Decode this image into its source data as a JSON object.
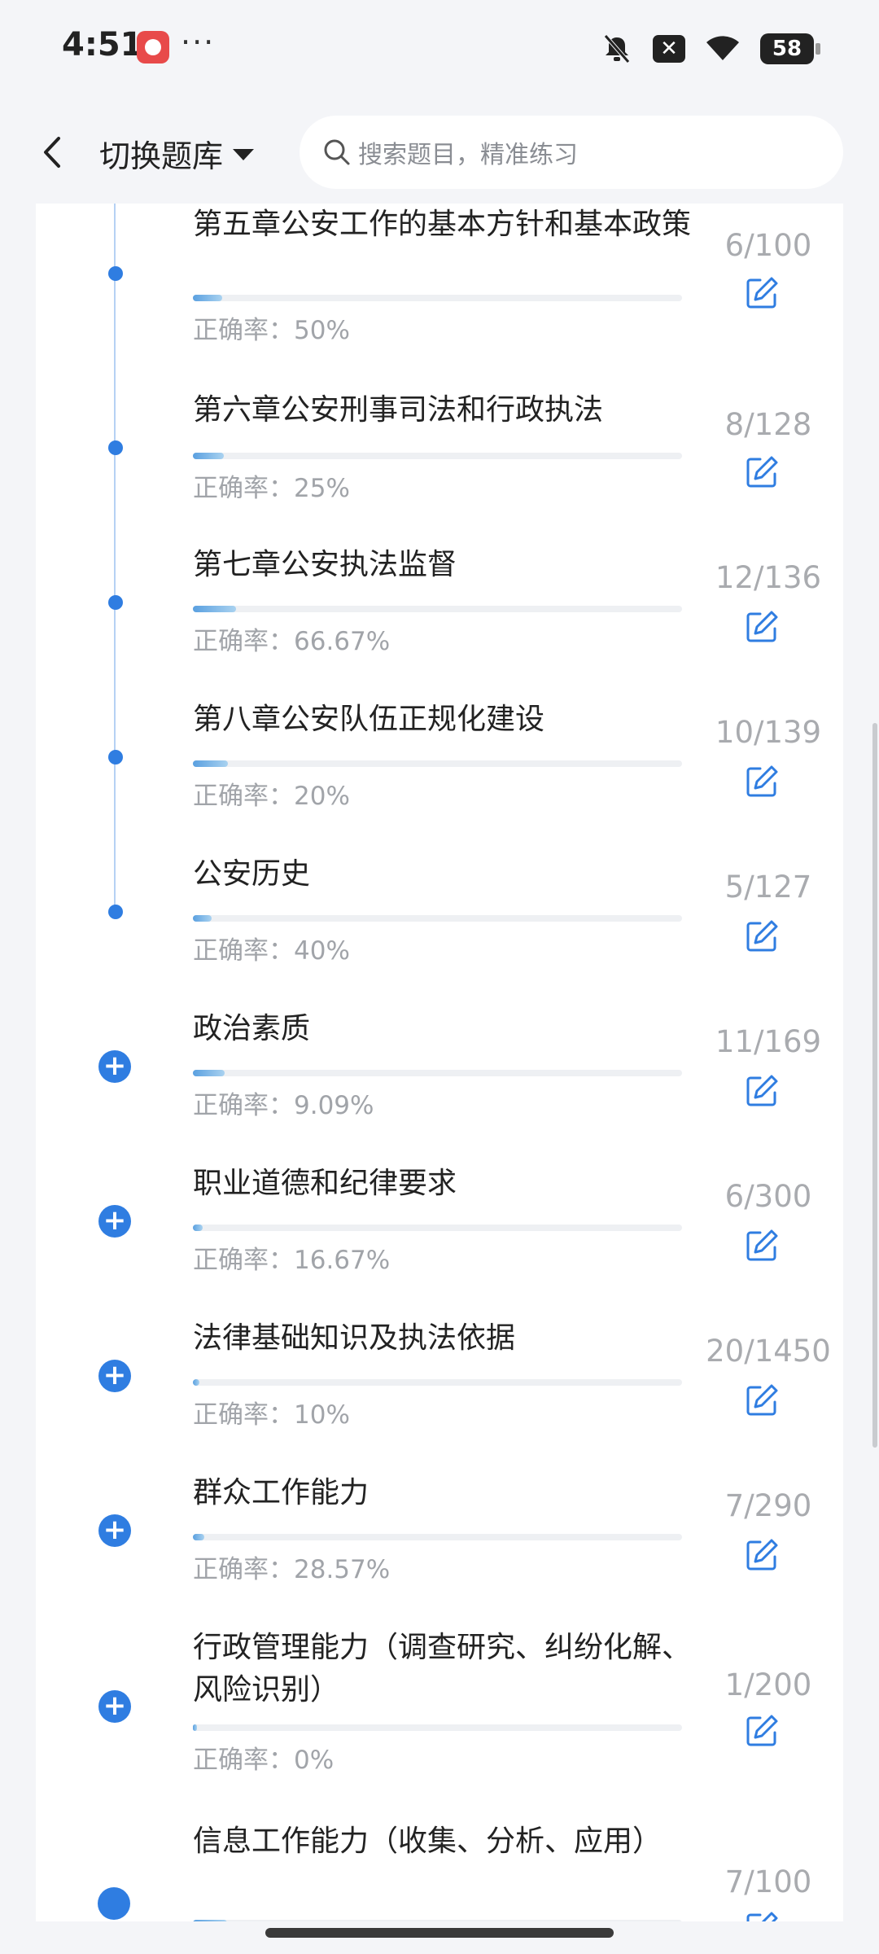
{
  "status_bar": {
    "time": "4:51",
    "more": "···",
    "battery": "58"
  },
  "header": {
    "back_icon": "chevron-left-icon",
    "switch_label": "切换题库",
    "search_placeholder": "搜索题目，精准练习"
  },
  "accent_color": "#2f7de1",
  "accuracy_label": "正确率：",
  "items": [
    {
      "title": "第五章公安工作的基本方针和基本政策",
      "accuracy": "50%",
      "count": "6/100",
      "progress": 0.06,
      "marker": "dot"
    },
    {
      "title": "第六章公安刑事司法和行政执法",
      "accuracy": "25%",
      "count": "8/128",
      "progress": 0.0625,
      "marker": "dot"
    },
    {
      "title": "第七章公安执法监督",
      "accuracy": "66.67%",
      "count": "12/136",
      "progress": 0.088,
      "marker": "dot"
    },
    {
      "title": "第八章公安队伍正规化建设",
      "accuracy": "20%",
      "count": "10/139",
      "progress": 0.072,
      "marker": "dot"
    },
    {
      "title": "公安历史",
      "accuracy": "40%",
      "count": "5/127",
      "progress": 0.039,
      "marker": "dot"
    },
    {
      "title": "政治素质",
      "accuracy": "9.09%",
      "count": "11/169",
      "progress": 0.065,
      "marker": "plus"
    },
    {
      "title": "职业道德和纪律要求",
      "accuracy": "16.67%",
      "count": "6/300",
      "progress": 0.02,
      "marker": "plus"
    },
    {
      "title": "法律基础知识及执法依据",
      "accuracy": "10%",
      "count": "20/1450",
      "progress": 0.014,
      "marker": "plus"
    },
    {
      "title": "群众工作能力",
      "accuracy": "28.57%",
      "count": "7/290",
      "progress": 0.024,
      "marker": "plus"
    },
    {
      "title": "行政管理能力（调查研究、纠纷化解、风险识别）",
      "accuracy": "0%",
      "count": "1/200",
      "progress": 0.005,
      "marker": "plus"
    },
    {
      "title": "信息工作能力（收集、分析、应用）",
      "accuracy": "",
      "count": "7/100",
      "progress": 0.07,
      "marker": "bigdot"
    }
  ]
}
